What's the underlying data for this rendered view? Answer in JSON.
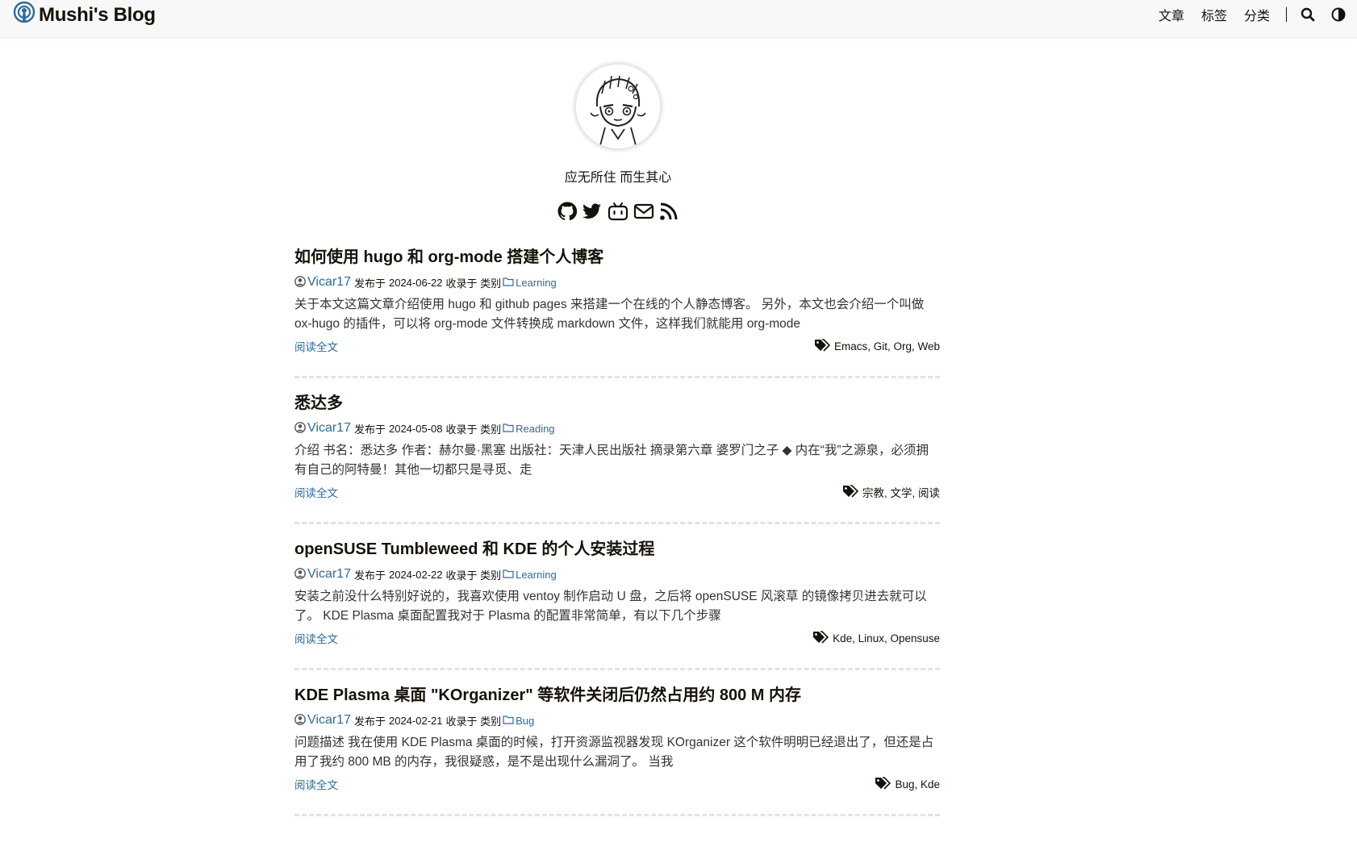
{
  "site": {
    "title": "Mushi's Blog"
  },
  "nav": {
    "items": [
      {
        "label": "文章"
      },
      {
        "label": "标签"
      },
      {
        "label": "分类"
      }
    ],
    "search_icon": "search-icon",
    "theme_icon": "theme-toggle-icon"
  },
  "profile": {
    "subtitle": "应无所住 而生其心",
    "social": [
      "github-icon",
      "twitter-icon",
      "bilibili-icon",
      "email-icon",
      "rss-icon"
    ]
  },
  "labels": {
    "published": "发布于",
    "category": "收录于 类别",
    "read_more": "阅读全文"
  },
  "posts": [
    {
      "title": "如何使用 hugo 和 org-mode 搭建个人博客",
      "author": "Vicar17",
      "date": "2024-06-22",
      "category": "Learning",
      "summary": "关于本文这篇文章介绍使用 hugo 和 github pages 来搭建一个在线的个人静态博客。 另外，本文也会介绍一个叫做 ox-hugo 的插件，可以将 org-mode 文件转换成 markdown 文件，这样我们就能用 org-mode",
      "tags": "Emacs, Git, Org, Web"
    },
    {
      "title": "悉达多",
      "author": "Vicar17",
      "date": "2024-05-08",
      "category": "Reading",
      "summary": "介绍 书名：悉达多 作者：赫尔曼·黑塞 出版社：天津人民出版社 摘录第六章 婆罗门之子 ◆ 内在“我”之源泉，必须拥有自己的阿特曼！其他一切都只是寻觅、走",
      "tags": "宗教, 文学, 阅读"
    },
    {
      "title": "openSUSE Tumbleweed 和 KDE 的个人安装过程",
      "author": "Vicar17",
      "date": "2024-02-22",
      "category": "Learning",
      "summary": "安装之前没什么特别好说的，我喜欢使用 ventoy 制作启动 U 盘，之后将 openSUSE 风滚草 的镜像拷贝进去就可以了。 KDE Plasma 桌面配置我对于 Plasma 的配置非常简单，有以下几个步骤",
      "tags": "Kde, Linux, Opensuse"
    },
    {
      "title": "KDE Plasma 桌面 \"KOrganizer\" 等软件关闭后仍然占用约 800 M 内存",
      "author": "Vicar17",
      "date": "2024-02-21",
      "category": "Bug",
      "summary": "问题描述 我在使用 KDE Plasma 桌面的时候，打开资源监视器发现 KOrganizer 这个软件明明已经退出了，但还是占用了我约 800 MB 的内存，我很疑惑，是不是出现什么漏洞了。 当我",
      "tags": "Bug, Kde"
    }
  ],
  "colors": {
    "link": "#2d6b9a",
    "text": "#161209",
    "header_bg": "#f8f8f8"
  }
}
